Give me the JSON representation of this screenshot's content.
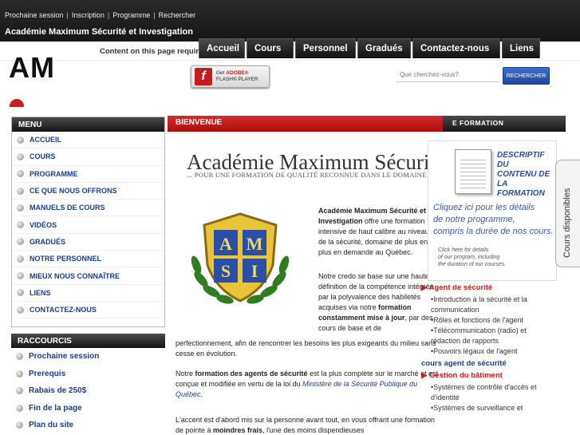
{
  "toplinks": {
    "l1": "Prochaine session",
    "l2": "Inscription",
    "l3": "Programme",
    "l4": "Rechercher",
    "sep": "|"
  },
  "brand": "Académie Maximum Sécurité et Investigation",
  "notice": "Content on this page requires a newer version of Adobe Flash Player.",
  "nav": {
    "t1": "Accueil",
    "t2": "Cours",
    "t3": "Personnel",
    "t4": "Gradués",
    "t5": "Contactez-nous",
    "t6": "Liens"
  },
  "logo": "AM",
  "flash": {
    "l1": "Get",
    "l2": "ADOBE®",
    "l3": "FLASH® PLAYER"
  },
  "search": {
    "placeholder": "Que cherchez-vous?",
    "button": "RECHERCHER"
  },
  "menu": {
    "title": "MENU",
    "items": [
      "ACCUEIL",
      "COURS",
      "PROGRAMME",
      "CE QUE NOUS OFFRONS",
      "MANUELS DE COURS",
      "VIDÉOS",
      "GRADUÉS",
      "NOTRE PERSONNEL",
      "MIEUX NOUS CONNAÎTRE",
      "LIENS",
      "CONTACTEZ-NOUS"
    ]
  },
  "shortcuts": {
    "title": "RACCOURCIS",
    "items": [
      "Prochaine session",
      "Prerequis",
      "Rabais de 250$",
      "Fin de la page",
      "Plan du site"
    ]
  },
  "center": {
    "header": "BIENVENUE",
    "title": "Académie Maximum Sécurité et Investigation",
    "subtitle": "... POUR UNE FORMATION DE QUALITÉ RECONNUE DANS LE DOMAINE",
    "crest": {
      "a": "A",
      "m": "M",
      "s": "S",
      "i": "I"
    },
    "p1_bold": "Académie Maximum Sécurité et Investigation",
    "p1_rest": " offre une formation intensive de haut calibre au niveau de la sécurité, domaine de plus en plus en demande au Québec.",
    "p2_a": "Notre credo se base sur une haute définition de la compétence intégrée par la polyvalence des habiletés acquises via notre ",
    "p2_bold": "formation constamment mise à jour",
    "p2_b": ", par des cours de base et de",
    "p2_cont": "perfectionnement, afin de rencontrer les besoins les plus exigeants du milieu sans cesse en évolution.",
    "p3_a": "Notre ",
    "p3_bold": "formation des agents de sécurité",
    "p3_b": " est la plus complète sur le marché et est conçue et modifiée en vertu de la loi du ",
    "p3_link": "Ministère de la Sécurité Publique du Québec",
    "p3_c": ".",
    "p4_a": "L'accent est d'abord mis sur la personne avant tout, en vous offrant une formation de pointe à ",
    "p4_bold": "moindres frais",
    "p4_b": ", l'une des moins dispendieuses"
  },
  "right": {
    "caption": "E FORMATION",
    "promo": {
      "title1": "DESCRIPTIF DU",
      "title2": "CONTENU DE LA",
      "title3": "FORMATION",
      "fr1": "Cliquez ici pour les détails",
      "fr2": "de notre programme,",
      "fr3": "compris la durée de nos cours.",
      "en1": "Click here for details",
      "en2": "of our program, including",
      "en3": "the duration of our courses."
    },
    "sidetab": "Cours disponibles",
    "sec1": "Agent de sécurité",
    "items1": [
      "Introduction à la sécurité et la communication",
      "Rôles et fonctions de l'agent",
      "Télécommunication (radio) et rédaction de rapports",
      "Pouvoirs légaux de l'agent"
    ],
    "sec2": "cours agent de sécurité",
    "sec3": "Gestion du bâtiment",
    "items3": [
      "Systèmes de contrôle d'accès et d'identité",
      "Systèmes de surveillance et"
    ]
  }
}
